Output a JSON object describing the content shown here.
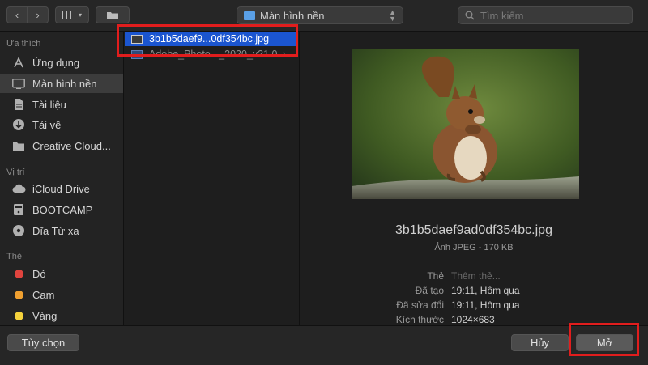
{
  "toolbar": {
    "location": "Màn hình nền",
    "search_placeholder": "Tìm kiếm"
  },
  "sidebar": {
    "favorites_header": "Ưa thích",
    "favorites": [
      {
        "label": "Ứng dụng",
        "icon": "apps-icon"
      },
      {
        "label": "Màn hình nền",
        "icon": "desktop-icon",
        "selected": true
      },
      {
        "label": "Tài liệu",
        "icon": "document-icon"
      },
      {
        "label": "Tải về",
        "icon": "download-icon"
      },
      {
        "label": "Creative Cloud...",
        "icon": "folder-icon"
      }
    ],
    "locations_header": "Vị trí",
    "locations": [
      {
        "label": "iCloud Drive",
        "icon": "cloud-icon"
      },
      {
        "label": "BOOTCAMP",
        "icon": "drive-icon"
      },
      {
        "label": "Đĩa Từ xa",
        "icon": "disc-icon"
      }
    ],
    "tags_header": "Thẻ",
    "tags": [
      {
        "label": "Đỏ",
        "color": "#e0443e"
      },
      {
        "label": "Cam",
        "color": "#f0a030"
      },
      {
        "label": "Vàng",
        "color": "#f5d23c"
      }
    ]
  },
  "files": [
    {
      "name": "3b1b5daef9...0df354bc.jpg",
      "selected": true
    },
    {
      "name": "Adobe_Photo..._2020_v21.0",
      "selected": false
    }
  ],
  "preview": {
    "filename": "3b1b5daef9ad0df354bc.jpg",
    "subtitle": "Ảnh JPEG - 170 KB",
    "meta": [
      {
        "key": "Thẻ",
        "value": "Thêm thẻ...",
        "placeholder": true
      },
      {
        "key": "Đã tạo",
        "value": "19:11, Hôm qua"
      },
      {
        "key": "Đã sửa đổi",
        "value": "19:11, Hôm qua"
      },
      {
        "key": "Kích thước",
        "value": "1024×683"
      }
    ]
  },
  "buttons": {
    "options": "Tùy chọn",
    "cancel": "Hủy",
    "open": "Mở"
  },
  "colors": {
    "selection": "#1b55d0",
    "highlight_box": "#e11d1d"
  }
}
